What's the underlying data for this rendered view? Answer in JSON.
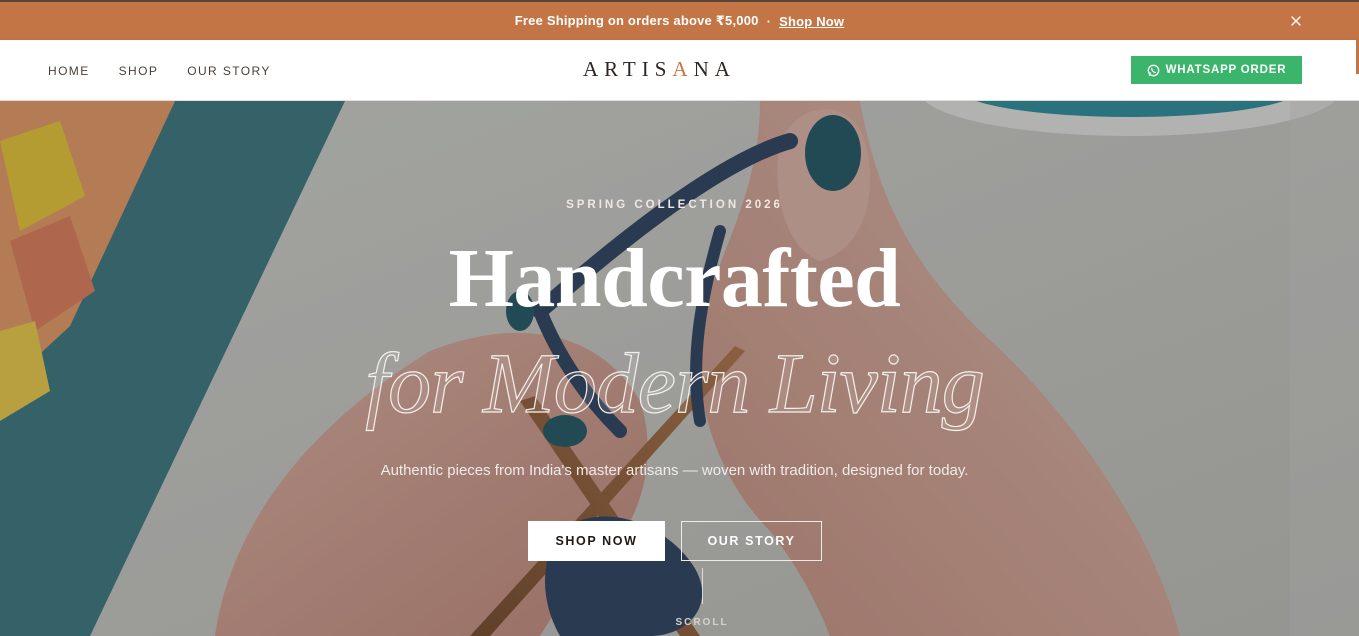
{
  "announcement": {
    "text": "Free Shipping on orders above ₹5,000",
    "separator": "·",
    "link_label": "Shop Now",
    "close_icon": "close-icon",
    "background": "#c47545"
  },
  "header": {
    "nav": [
      "HOME",
      "SHOP",
      "OUR STORY"
    ],
    "logo": {
      "before": "ARTIS",
      "accent": "A",
      "after": "NA"
    },
    "whatsapp_label": "WHATSAPP ORDER",
    "whatsapp_icon": "whatsapp-icon",
    "whatsapp_color": "#3bb56b"
  },
  "hero": {
    "eyebrow": "SPRING COLLECTION 2026",
    "headline": "Handcrafted",
    "subheadline": "for Modern Living",
    "description": "Authentic pieces from India's master artisans — woven with tradition, designed for today.",
    "primary_cta": "SHOP NOW",
    "secondary_cta": "OUR STORY",
    "scroll_label": "SCROLL"
  },
  "colors": {
    "accent": "#c47545",
    "text_dark": "#2d2622",
    "whatsapp": "#3bb56b"
  }
}
